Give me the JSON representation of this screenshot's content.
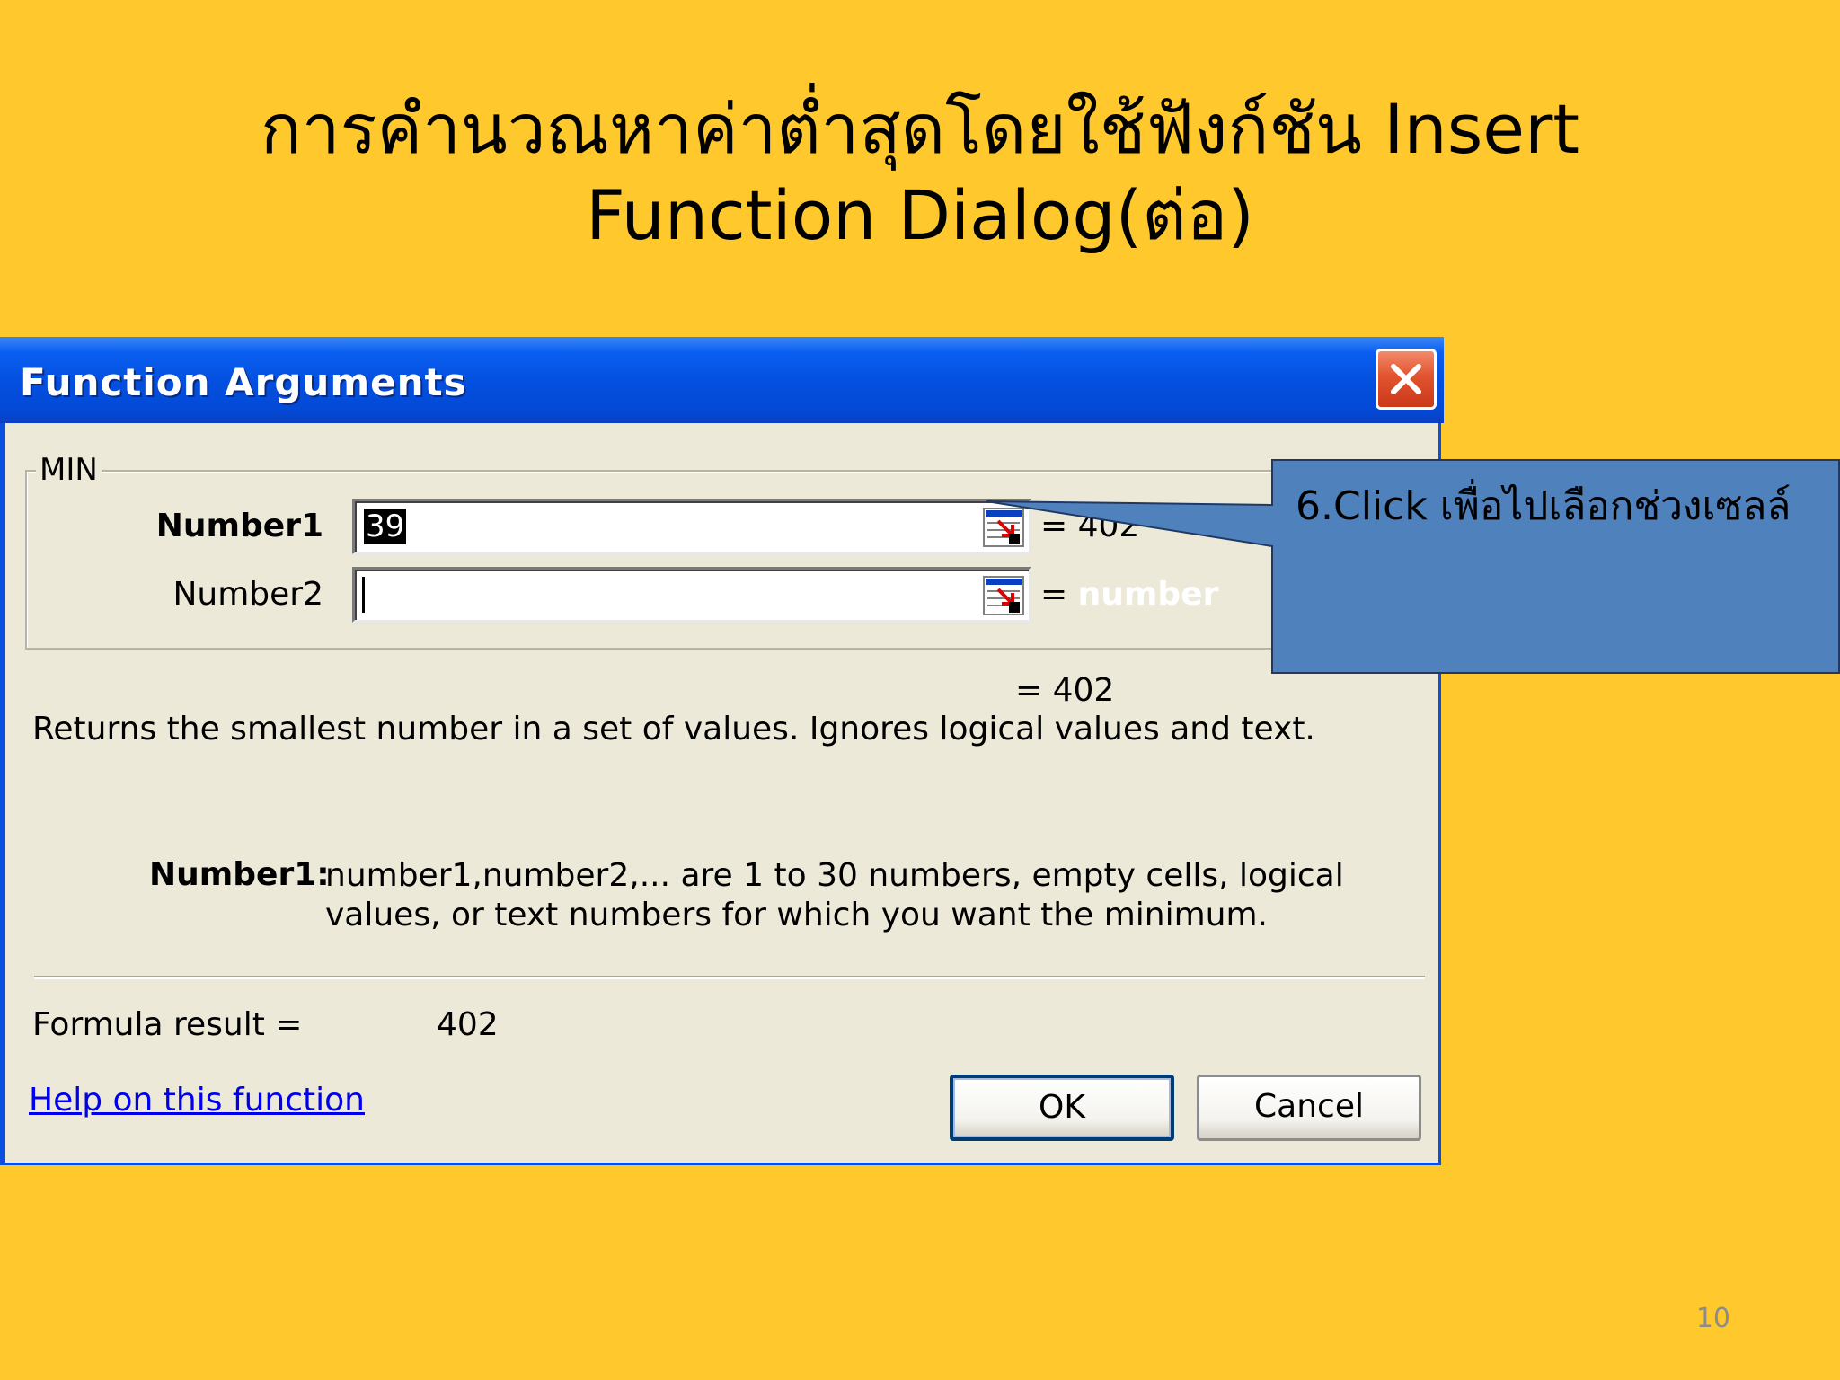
{
  "slide": {
    "title_line1": "การคำนวณหาค่าต่ำสุดโดยใช้ฟังก์ชัน Insert",
    "title_line2": "Function Dialog(ต่อ)",
    "page_number": "10",
    "background_color": "#FFC92D"
  },
  "dialog": {
    "title": "Function Arguments",
    "close_icon": "close-icon",
    "function_name": "MIN",
    "arguments": [
      {
        "label": "Number1",
        "value": "39",
        "result": "= 402"
      },
      {
        "label": "Number2",
        "value": "",
        "result": "= number"
      }
    ],
    "result_line": "= 402",
    "description": "Returns the smallest number in a set of values. Ignores logical values and text.",
    "arg_help_name": "Number1:",
    "arg_help_text": "number1,number2,... are 1 to 30 numbers, empty cells, logical values, or text numbers for which you want the minimum.",
    "formula_result_label": "Formula result =",
    "formula_result_value": "402",
    "help_link": "Help on this function",
    "ok_label": "OK",
    "cancel_label": "Cancel",
    "collapse_icon": "collapse-dialog-icon"
  },
  "callout": {
    "text": "6.Click เพื่อไปเลือกช่วงเซลล์",
    "fill_color": "#4F81BD"
  }
}
